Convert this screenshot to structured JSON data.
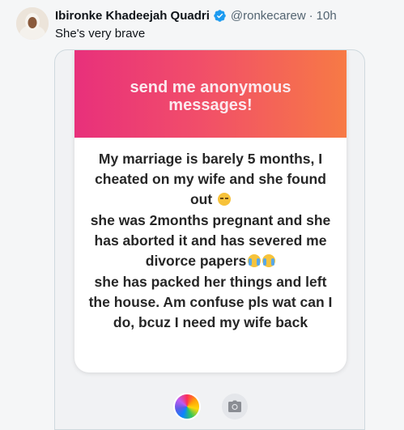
{
  "tweet": {
    "author_name": "Ibironke Khadeejah Quadri",
    "handle": "@ronkecarew",
    "separator": "·",
    "time": "10h",
    "text": "She's very brave"
  },
  "media": {
    "card_title": "send me anonymous messages!",
    "message_paragraphs": [
      "My marriage is barely 5 months, I cheated on my wife and she found out",
      "she was 2months pregnant and she has aborted it and has severed me divorce papers",
      "she has packed her things and left the house. Am confuse pls wat can I do, bcuz I need my wife back"
    ],
    "colors": {
      "gradient_start": "#e8307b",
      "gradient_end": "#f77a45",
      "verified_badge": "#1d9bf0"
    },
    "icons": [
      "verified-badge-icon",
      "sad-face-emoji",
      "crying-face-emoji",
      "color-picker-icon",
      "camera-icon"
    ]
  }
}
